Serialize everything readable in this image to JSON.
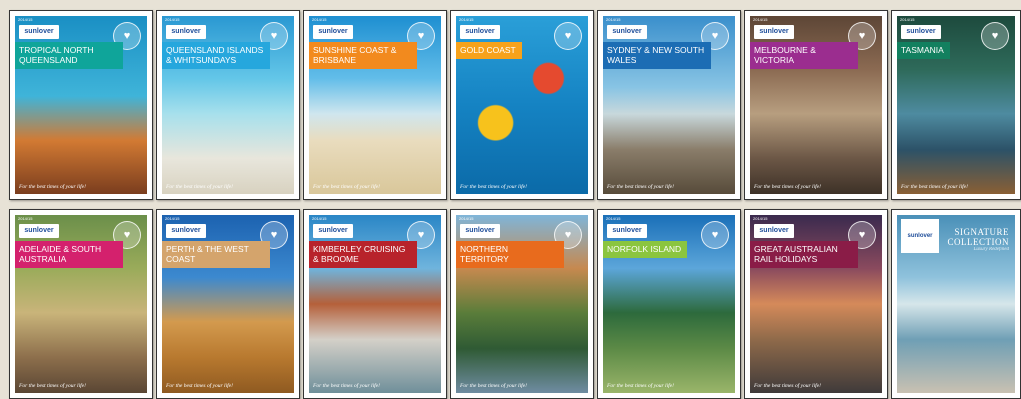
{
  "brand": {
    "logo_text": "sunlover",
    "year": "2014/15",
    "tagline": "For the best times of your life!"
  },
  "brochures": [
    {
      "id": "tnq",
      "title": "TROPICAL NORTH QUEENSLAND",
      "label_color": "#0fa59a",
      "bg": "linear-gradient(180deg,#1a8fc4 0%,#3fb4d9 45%,#d27a33 70%,#7a3d1e 100%)"
    },
    {
      "id": "qld",
      "title": "QUEENSLAND ISLANDS & WHITSUNDAYS",
      "label_color": "#26a7dd",
      "bg": "linear-gradient(180deg,#2a98d2 0%,#63c6e8 35%,#a7e0ec 55%,#e8e6dc 80%,#d8d2c0 100%)"
    },
    {
      "id": "sun",
      "title": "SUNSHINE COAST & BRISBANE",
      "label_color": "#f28a1e",
      "bg": "linear-gradient(180deg,#1e8fd1 0%,#62bde9 35%,#cfe6ee 55%,#e9dcbe 70%,#d9c79a 100%)"
    },
    {
      "id": "gold",
      "title": "GOLD COAST",
      "label_color": "#f7a21b",
      "bg": "radial-gradient(circle at 30% 60%,#f7c21c 0 12%,transparent 13%),radial-gradient(circle at 70% 35%,#e54a2f 0 10%,transparent 11%),linear-gradient(180deg,#2a9fd8 0%,#1583c3 50%,#0b6aa8 100%)"
    },
    {
      "id": "nsw",
      "title": "SYDNEY & NEW SOUTH WALES",
      "label_color": "#1c6db4",
      "bg": "linear-gradient(180deg,#3a8fcc 0%,#88c4e4 40%,#c8d8dc 55%,#8a7d6a 75%,#574b3a 100%)"
    },
    {
      "id": "vic",
      "title": "MELBOURNE & VICTORIA",
      "label_color": "#9b2d8f",
      "bg": "linear-gradient(180deg,#5d4636 0%,#8b6a52 30%,#b79e7f 55%,#6c5746 80%,#3d3127 100%)"
    },
    {
      "id": "tas",
      "title": "TASMANIA",
      "label_color": "#12805f",
      "bg": "linear-gradient(180deg,#1d4a3d 0%,#2e6a5a 30%,#4e8ba0 55%,#2c5268 75%,#8a5f34 100%)"
    },
    {
      "id": "sa",
      "title": "ADELAIDE & SOUTH AUSTRALIA",
      "label_color": "#d4216d",
      "bg": "linear-gradient(180deg,#6b8f4a 0%,#9aab5a 30%,#c9b47a 55%,#8d6f4c 80%,#5a4634 100%)"
    },
    {
      "id": "wa",
      "title": "PERTH & THE WEST COAST",
      "label_color": "#d4a46c",
      "bg": "linear-gradient(180deg,#1c62b0 0%,#3c89cf 35%,#d39a4e 60%,#b8792f 80%,#8f5a21 100%)"
    },
    {
      "id": "kim",
      "title": "KIMBERLEY CRUISING & BROOME",
      "label_color": "#b8232b",
      "bg": "linear-gradient(180deg,#2a86c6 0%,#6fb4dd 30%,#b5603a 50%,#d4d0c8 70%,#6f8f9a 100%)"
    },
    {
      "id": "nt",
      "title": "NORTHERN TERRITORY",
      "label_color": "#e86b1d",
      "bg": "linear-gradient(180deg,#7fb5d9 0%,#c6894f 30%,#5a7d3a 55%,#2f5a34 75%,#6f8ca2 100%)"
    },
    {
      "id": "nfi",
      "title": "NORFOLK ISLAND",
      "label_color": "#8bc53f",
      "bg": "linear-gradient(180deg,#1a6fb8 0%,#5ca6da 30%,#2d6a3c 55%,#5c8a46 75%,#9ab56a 100%)"
    },
    {
      "id": "rail",
      "title": "GREAT AUSTRALIAN RAIL HOLIDAYS",
      "label_color": "#8a1c47",
      "bg": "linear-gradient(180deg,#3a2a4e 0%,#8a4a5e 30%,#d58a5a 50%,#8f6a4a 70%,#3f3a3a 100%)"
    },
    {
      "id": "sig",
      "title": "SIGNATURE COLLECTION",
      "subtitle": "Luxury Redefined",
      "label_color": "#ffffff",
      "bg": "linear-gradient(180deg,#4a90b8 0%,#8fc2dc 35%,#d6e6ea 50%,#6f9fb5 70%,#c9c1b2 100%)"
    }
  ]
}
